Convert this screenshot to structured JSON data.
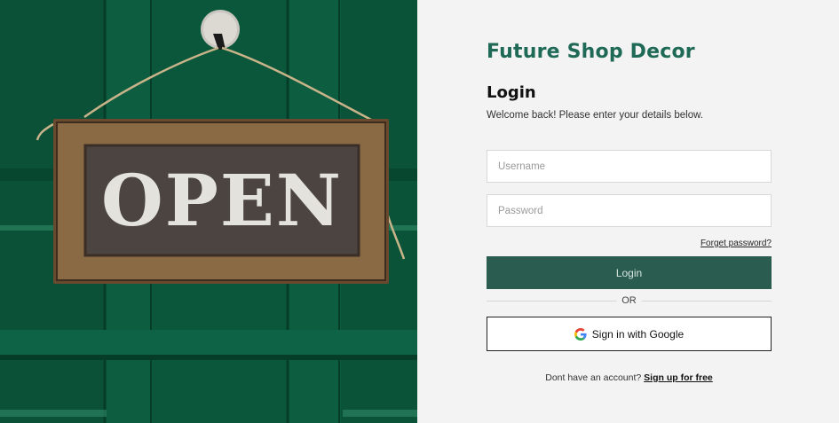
{
  "hero": {
    "sign_text": "OPEN"
  },
  "brand": {
    "name": "Future Shop Decor",
    "color": "#1e6a56"
  },
  "login": {
    "heading": "Login",
    "subtitle": "Welcome back! Please enter your details below.",
    "username_placeholder": "Username",
    "password_placeholder": "Password",
    "forgot_label": "Forget password?",
    "login_button": "Login",
    "login_button_color": "#2a5c4f",
    "divider": "OR",
    "google_button": "Sign in with Google",
    "google_icon": "google-g-icon",
    "signup_prompt": "Dont have an account?",
    "signup_link": "Sign up for free"
  }
}
